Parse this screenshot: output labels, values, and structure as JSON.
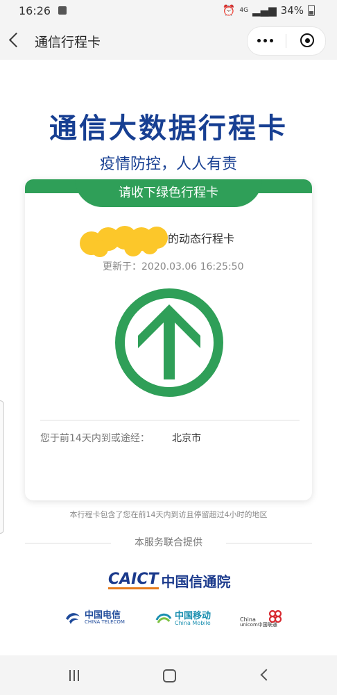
{
  "status": {
    "time": "16:26",
    "network": "4G",
    "battery": "34%"
  },
  "nav": {
    "title": "通信行程卡"
  },
  "header": {
    "title": "通信大数据行程卡",
    "subtitle": "疫情防控，人人有责"
  },
  "card": {
    "tab_label": "请收下绿色行程卡",
    "trip_label": "的动态行程卡",
    "update_prefix": "更新于：",
    "update_time": "2020.03.06 16:25:50",
    "route_label": "您于前14天内到或途经：",
    "route_value": "北京市",
    "status_color": "#2f9f58"
  },
  "footnote": "本行程卡包含了您在前14天内到访且停留超过4小时的地区",
  "provider": {
    "label": "本服务联合提供",
    "caict_en": "CAICT",
    "caict_cn": "中国信通院",
    "telecom_cn": "中国电信",
    "telecom_en": "CHINA TELECOM",
    "mobile_cn": "中国移动",
    "mobile_en": "China Mobile",
    "unicom_en_1": "China",
    "unicom_en_2": "unicom中国联通"
  },
  "icons": {
    "back": "back-icon",
    "more": "more-icon",
    "close": "close-icon",
    "arrow": "up-arrow-icon"
  }
}
